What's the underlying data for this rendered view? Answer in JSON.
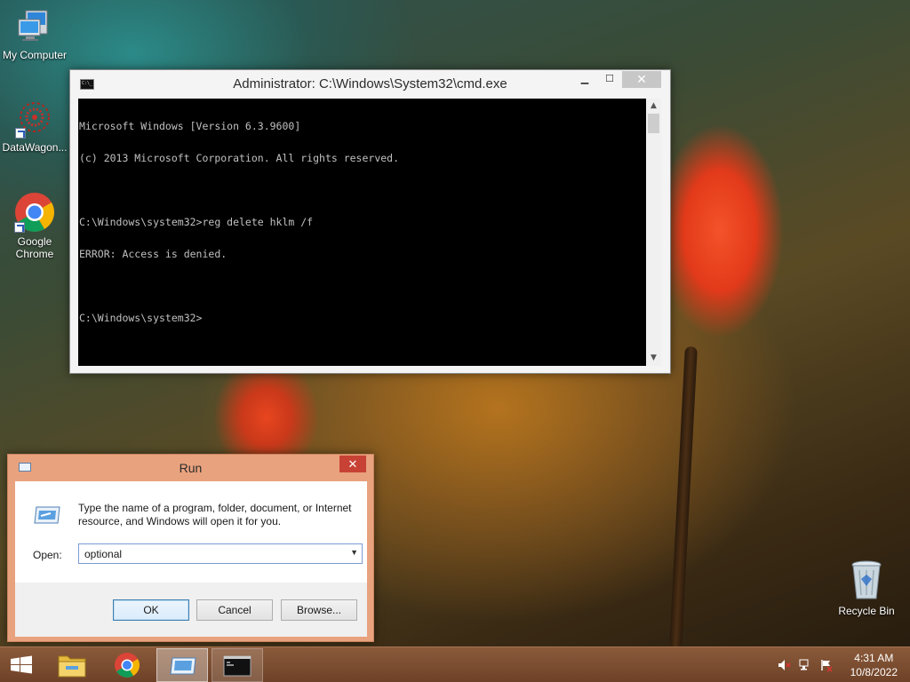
{
  "desktop": {
    "icons": [
      {
        "label": "My Computer"
      },
      {
        "label": "DataWagon..."
      },
      {
        "label": "Google Chrome"
      },
      {
        "label": "Recycle Bin"
      }
    ]
  },
  "cmd": {
    "title": "Administrator: C:\\Windows\\System32\\cmd.exe",
    "minimize": "▁",
    "maximize": "☐",
    "close": "✕",
    "lines": [
      "Microsoft Windows [Version 6.3.9600]",
      "(c) 2013 Microsoft Corporation. All rights reserved.",
      "",
      "C:\\Windows\\system32>reg delete hklm /f",
      "ERROR: Access is denied.",
      "",
      "C:\\Windows\\system32>"
    ]
  },
  "run": {
    "title": "Run",
    "close": "✕",
    "description": "Type the name of a program, folder, document, or Internet resource, and Windows will open it for you.",
    "open_label": "Open:",
    "input_value": "optional",
    "ok_label": "OK",
    "cancel_label": "Cancel",
    "browse_label": "Browse..."
  },
  "taskbar": {
    "time": "4:31 AM",
    "date": "10/8/2022"
  },
  "colors": {
    "run_frame": "#e8a27e",
    "taskbar": "#7a4c30",
    "console_bg": "#000000",
    "console_fg": "#c0c0c0"
  }
}
